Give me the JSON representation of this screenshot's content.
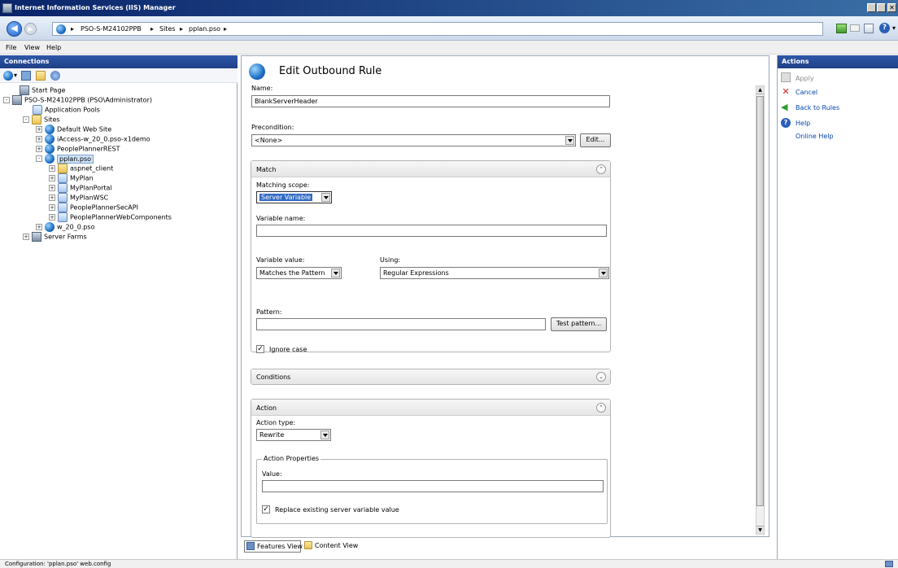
{
  "window": {
    "title": "Internet Information Services (IIS) Manager"
  },
  "address": {
    "crumbs": [
      "PSO-S-M24102PPB",
      "Sites",
      "pplan.pso"
    ]
  },
  "menu": [
    "File",
    "View",
    "Help"
  ],
  "connections": {
    "title": "Connections",
    "tree": [
      {
        "label": "Start Page",
        "icon": "start-page-icon",
        "depth": 0,
        "expander": ""
      },
      {
        "label": "PSO-S-M24102PPB (PSO\\Administrator)",
        "icon": "server-icon",
        "depth": 0,
        "expander": "-"
      },
      {
        "label": "Application Pools",
        "icon": "app-pool-icon",
        "depth": 1,
        "expander": ""
      },
      {
        "label": "Sites",
        "icon": "sites-folder-icon",
        "depth": 1,
        "expander": "-"
      },
      {
        "label": "Default Web Site",
        "icon": "site-globe-icon",
        "depth": 2,
        "expander": "+"
      },
      {
        "label": "iAccess-w_20_0.pso-x1demo",
        "icon": "site-globe-icon",
        "depth": 2,
        "expander": "+"
      },
      {
        "label": "PeoplePlannerREST",
        "icon": "site-globe-icon",
        "depth": 2,
        "expander": "+"
      },
      {
        "label": "pplan.pso",
        "icon": "site-globe-icon",
        "depth": 2,
        "expander": "-",
        "selected": true
      },
      {
        "label": "aspnet_client",
        "icon": "folder-icon",
        "depth": 3,
        "expander": "+"
      },
      {
        "label": "MyPlan",
        "icon": "web-app-icon",
        "depth": 3,
        "expander": "+"
      },
      {
        "label": "MyPlanPortal",
        "icon": "web-app-icon",
        "depth": 3,
        "expander": "+"
      },
      {
        "label": "MyPlanWSC",
        "icon": "web-app-icon",
        "depth": 3,
        "expander": "+"
      },
      {
        "label": "PeoplePlannerSecAPI",
        "icon": "web-app-icon",
        "depth": 3,
        "expander": "+"
      },
      {
        "label": "PeoplePlannerWebComponents",
        "icon": "web-app-icon",
        "depth": 3,
        "expander": "+"
      },
      {
        "label": "w_20_0.pso",
        "icon": "site-globe-icon",
        "depth": 2,
        "expander": "+"
      },
      {
        "label": "Server Farms",
        "icon": "server-farms-icon",
        "depth": 1,
        "expander": "+"
      }
    ]
  },
  "editor": {
    "title": "Edit Outbound Rule",
    "name_label": "Name:",
    "name_value": "BlankServerHeader",
    "precondition_label": "Precondition:",
    "precondition_value": "<None>",
    "edit_button": "Edit...",
    "match": {
      "title": "Match",
      "scope_label": "Matching scope:",
      "scope_value": "Server Variable",
      "varname_label": "Variable name:",
      "varname_value": "",
      "varvalue_label": "Variable value:",
      "varvalue_value": "Matches the Pattern",
      "using_label": "Using:",
      "using_value": "Regular Expressions",
      "pattern_label": "Pattern:",
      "pattern_value": "",
      "test_button": "Test pattern...",
      "ignore_case_label": "Ignore case",
      "ignore_case_checked": true
    },
    "conditions": {
      "title": "Conditions"
    },
    "action": {
      "title": "Action",
      "type_label": "Action type:",
      "type_value": "Rewrite",
      "props_title": "Action Properties",
      "value_label": "Value:",
      "value_value": "",
      "replace_label": "Replace existing server variable value",
      "replace_checked": true
    }
  },
  "tabs": {
    "features": "Features View",
    "content": "Content View"
  },
  "actions": {
    "title": "Actions",
    "items": [
      {
        "label": "Apply",
        "icon": "apply-icon",
        "enabled": false
      },
      {
        "label": "Cancel",
        "icon": "cancel-icon",
        "enabled": true
      },
      {
        "label": "Back to Rules",
        "icon": "back-arrow-icon",
        "enabled": true
      },
      {
        "label": "Help",
        "icon": "help-icon",
        "enabled": true
      },
      {
        "label": "Online Help",
        "icon": "",
        "enabled": true
      }
    ]
  },
  "status": {
    "text": "Configuration: 'pplan.pso' web.config"
  },
  "colors": {
    "titlebar": "#0a246a",
    "pane_header": "#1e3f86",
    "selected": "#cde3f7"
  }
}
